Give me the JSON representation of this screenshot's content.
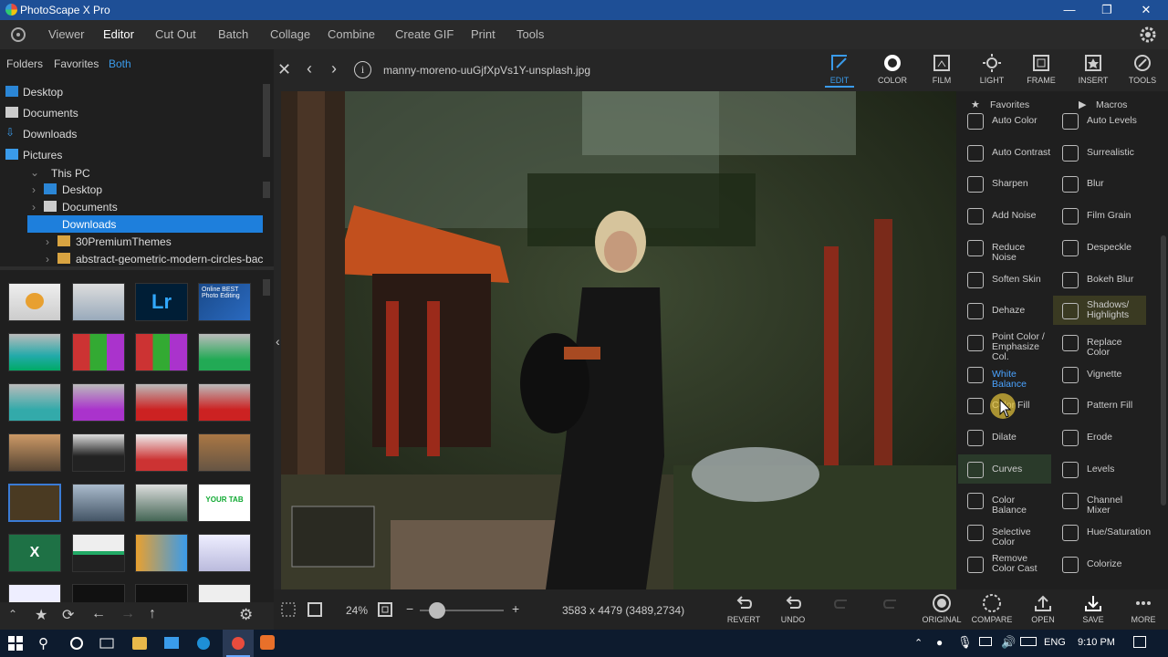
{
  "window": {
    "title": "PhotoScape X Pro",
    "min": "—",
    "max": "❐",
    "close": "✕"
  },
  "menu": {
    "items": [
      "Viewer",
      "Editor",
      "Cut Out",
      "Batch",
      "Collage",
      "Combine",
      "Create GIF",
      "Print",
      "Tools"
    ],
    "active": "Editor"
  },
  "left_tabs": [
    "Folders",
    "Favorites",
    "Both"
  ],
  "favorites": [
    "Desktop",
    "Documents",
    "Downloads",
    "Pictures"
  ],
  "tree": [
    {
      "label": "This PC",
      "indent": 0
    },
    {
      "label": "Desktop",
      "indent": 1
    },
    {
      "label": "Documents",
      "indent": 1
    },
    {
      "label": "Downloads",
      "indent": 1,
      "selected": true
    },
    {
      "label": "30PremiumThemes",
      "indent": 2
    },
    {
      "label": "abstract-geometric-modern-circles-backg",
      "indent": 2
    }
  ],
  "thumb_text": {
    "lr": "Lr",
    "online": "Online BEST Photo Editing",
    "excel": "X",
    "your_tab": "YOUR TAB"
  },
  "file": {
    "name": "manny-moreno-uuGjfXpVs1Y-unsplash.jpg"
  },
  "top_tools": [
    {
      "label": "EDIT",
      "icon": "edit-icon",
      "active": true
    },
    {
      "label": "COLOR",
      "icon": "color-icon"
    },
    {
      "label": "FILM",
      "icon": "film-icon"
    },
    {
      "label": "LIGHT",
      "icon": "light-icon"
    },
    {
      "label": "FRAME",
      "icon": "frame-icon"
    },
    {
      "label": "INSERT",
      "icon": "insert-icon"
    },
    {
      "label": "TOOLS",
      "icon": "tools-icon"
    }
  ],
  "right_panel": {
    "favorites": "Favorites",
    "macros": "Macros"
  },
  "filters": [
    [
      "Auto Color",
      "Auto Levels"
    ],
    [
      "Auto Contrast",
      "Surrealistic"
    ],
    [
      "Sharpen",
      "Blur"
    ],
    [
      "Add Noise",
      "Film Grain"
    ],
    [
      "Reduce Noise",
      "Despeckle"
    ],
    [
      "Soften Skin",
      "Bokeh Blur"
    ],
    [
      "Dehaze",
      "Shadows/ Highlights"
    ],
    [
      "Point Color / Emphasize Col.",
      "Replace Color"
    ],
    [
      "White Balance",
      "Vignette"
    ],
    [
      "Color Fill",
      "Pattern Fill"
    ],
    [
      "Dilate",
      "Erode"
    ],
    [
      "Curves",
      "Levels"
    ],
    [
      "Color Balance",
      "Channel Mixer"
    ],
    [
      "Selective Color",
      "Hue/Saturation"
    ],
    [
      "Remove Color Cast",
      "Colorize"
    ]
  ],
  "status": {
    "zoom": "24%",
    "dimensions": "3583 x 4479 (3489,2734)"
  },
  "status_buttons": [
    {
      "label": "REVERT",
      "icon": "revert-icon"
    },
    {
      "label": "UNDO",
      "icon": "undo-icon"
    },
    {
      "label": "",
      "icon": "redo-icon"
    },
    {
      "label": "",
      "icon": "redo-all-icon"
    },
    {
      "label": "ORIGINAL",
      "icon": "original-icon"
    },
    {
      "label": "COMPARE",
      "icon": "compare-icon"
    },
    {
      "label": "OPEN",
      "icon": "open-icon"
    },
    {
      "label": "SAVE",
      "icon": "save-icon"
    },
    {
      "label": "MORE",
      "icon": "more-icon"
    }
  ],
  "taskbar": {
    "lang": "ENG",
    "time": "9:10 PM"
  }
}
